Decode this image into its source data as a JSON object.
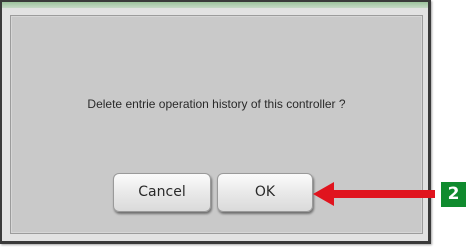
{
  "dialog": {
    "message": "Delete entrie operation history of this controller ?",
    "buttons": {
      "cancel_label": "Cancel",
      "ok_label": "OK"
    }
  },
  "annotation": {
    "step_number": "2",
    "arrow_color": "#e0141e",
    "badge_color": "#0f8b2e"
  },
  "colors": {
    "panel_background": "#c9c9c9",
    "frame_background": "#e2e2e2",
    "top_strip": "#9cc39c"
  }
}
